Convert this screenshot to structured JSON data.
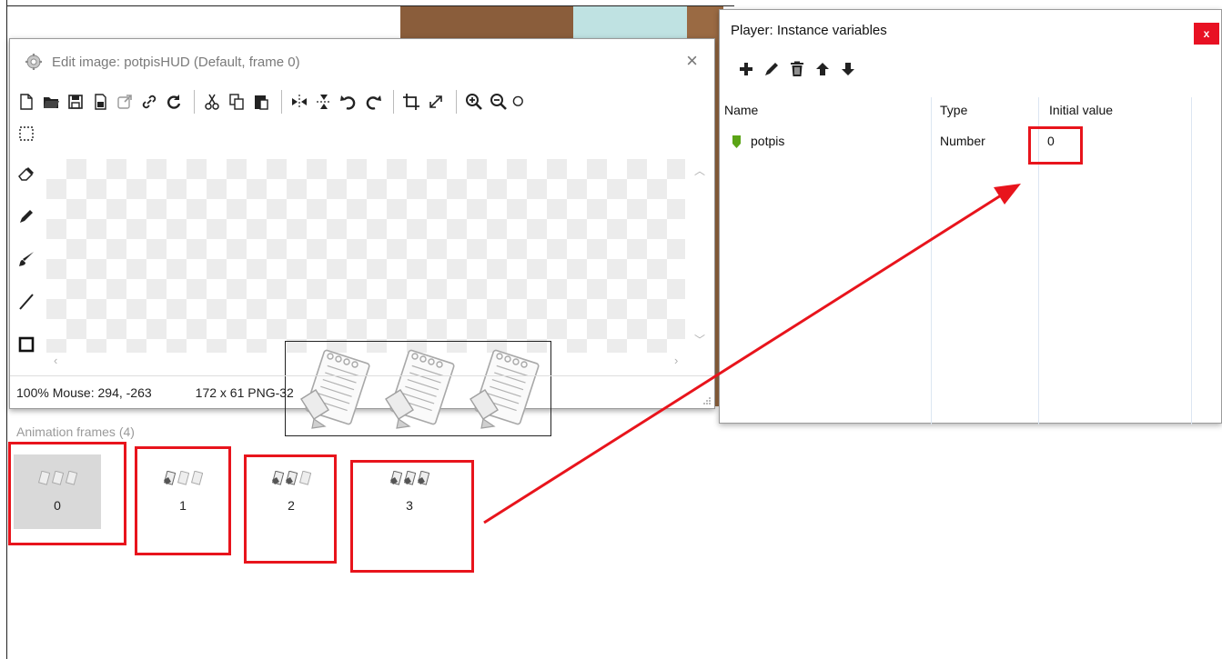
{
  "edit_window": {
    "title": "Edit image: potpisHUD (Default, frame 0)",
    "close_glyph": "×",
    "toolbar_icons": [
      "new-icon",
      "open-folder-icon",
      "save-icon",
      "save-as-icon",
      "export-icon",
      "link-icon",
      "reload-icon",
      "cut-icon",
      "copy-icon",
      "paste-icon",
      "flip-horizontal-icon",
      "flip-vertical-icon",
      "rotate-left-icon",
      "rotate-right-icon",
      "crop-icon",
      "resize-icon",
      "zoom-in-icon",
      "zoom-out-icon",
      "zoom-actual-icon"
    ],
    "side_tools": [
      "rectangle-select-icon",
      "eraser-icon",
      "pencil-icon",
      "brush-icon",
      "line-icon",
      "rectangle-icon"
    ],
    "status": {
      "zoom_mouse": "100% Mouse: 294, -263",
      "size_format": "172 x 61  PNG-32"
    }
  },
  "animation_frames": {
    "label": "Animation frames (4)",
    "frames": [
      {
        "number": "0",
        "selected": true
      },
      {
        "number": "1",
        "selected": false
      },
      {
        "number": "2",
        "selected": false
      },
      {
        "number": "3",
        "selected": false
      }
    ]
  },
  "vars_panel": {
    "title": "Player: Instance variables",
    "close_glyph": "x",
    "toolbar_icons": [
      "add-icon",
      "edit-pencil-icon",
      "delete-icon",
      "move-up-icon",
      "move-down-icon"
    ],
    "columns": [
      "Name",
      "Type",
      "Initial value"
    ],
    "rows": [
      {
        "name": "potpis",
        "type": "Number",
        "initial_value": "0"
      }
    ]
  },
  "colors": {
    "highlight_red": "#e8141c",
    "close_red": "#e81123",
    "row_icon_green": "#5ba416",
    "selected_frame_bg": "#d9d9d9"
  }
}
